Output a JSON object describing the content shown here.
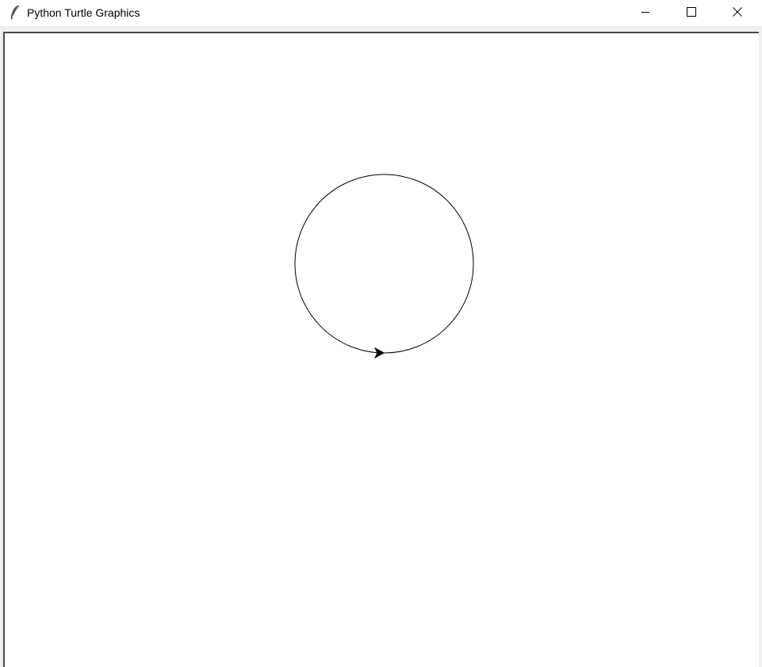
{
  "window": {
    "title": "Python Turtle Graphics",
    "app_icon": "feather-icon",
    "controls": {
      "minimize_icon": "minimize-icon",
      "maximize_icon": "maximize-icon",
      "close_icon": "close-icon"
    }
  },
  "canvas": {
    "background": "#ffffff",
    "drawing": {
      "shape": "circle",
      "stroke_color": "#000000",
      "turtle_shape": "classic-arrow",
      "turtle_heading": "east"
    }
  }
}
